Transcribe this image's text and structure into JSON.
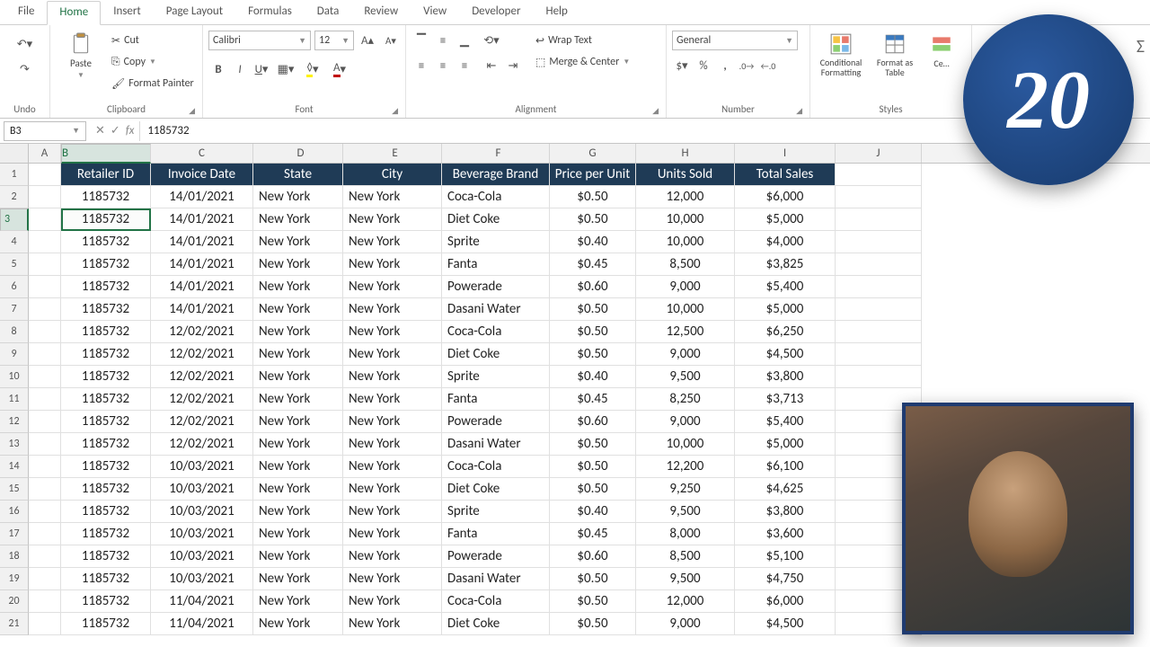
{
  "menu": {
    "tabs": [
      "File",
      "Home",
      "Insert",
      "Page Layout",
      "Formulas",
      "Data",
      "Review",
      "View",
      "Developer",
      "Help"
    ],
    "active": 1
  },
  "ribbon": {
    "undo": {
      "label": "Undo"
    },
    "clipboard": {
      "label": "Clipboard",
      "paste": "Paste",
      "cut": "Cut",
      "copy": "Copy",
      "format_painter": "Format Painter"
    },
    "font": {
      "label": "Font",
      "name": "Calibri",
      "size": "12"
    },
    "alignment": {
      "label": "Alignment",
      "wrap": "Wrap Text",
      "merge": "Merge & Center"
    },
    "number": {
      "label": "Number",
      "format": "General"
    },
    "styles": {
      "label": "Styles",
      "conditional": "Conditional Formatting",
      "format_table": "Format as Table",
      "cell_styles": "Cell Styles"
    }
  },
  "formula_bar": {
    "name_box": "B3",
    "value": "1185732"
  },
  "columns": [
    "A",
    "B",
    "C",
    "D",
    "E",
    "F",
    "G",
    "H",
    "I",
    "J"
  ],
  "headers": {
    "B": "Retailer ID",
    "C": "Invoice Date",
    "D": "State",
    "E": "City",
    "F": "Beverage Brand",
    "G": "Price per Unit",
    "H": "Units Sold",
    "I": "Total Sales"
  },
  "rows": [
    {
      "n": 2,
      "b": "1185732",
      "c": "14/01/2021",
      "d": "New York",
      "e": "New York",
      "f": "Coca-Cola",
      "g": "$0.50",
      "h": "12,000",
      "i": "$6,000"
    },
    {
      "n": 3,
      "b": "1185732",
      "c": "14/01/2021",
      "d": "New York",
      "e": "New York",
      "f": "Diet Coke",
      "g": "$0.50",
      "h": "10,000",
      "i": "$5,000"
    },
    {
      "n": 4,
      "b": "1185732",
      "c": "14/01/2021",
      "d": "New York",
      "e": "New York",
      "f": "Sprite",
      "g": "$0.40",
      "h": "10,000",
      "i": "$4,000"
    },
    {
      "n": 5,
      "b": "1185732",
      "c": "14/01/2021",
      "d": "New York",
      "e": "New York",
      "f": "Fanta",
      "g": "$0.45",
      "h": "8,500",
      "i": "$3,825"
    },
    {
      "n": 6,
      "b": "1185732",
      "c": "14/01/2021",
      "d": "New York",
      "e": "New York",
      "f": "Powerade",
      "g": "$0.60",
      "h": "9,000",
      "i": "$5,400"
    },
    {
      "n": 7,
      "b": "1185732",
      "c": "14/01/2021",
      "d": "New York",
      "e": "New York",
      "f": "Dasani Water",
      "g": "$0.50",
      "h": "10,000",
      "i": "$5,000"
    },
    {
      "n": 8,
      "b": "1185732",
      "c": "12/02/2021",
      "d": "New York",
      "e": "New York",
      "f": "Coca-Cola",
      "g": "$0.50",
      "h": "12,500",
      "i": "$6,250"
    },
    {
      "n": 9,
      "b": "1185732",
      "c": "12/02/2021",
      "d": "New York",
      "e": "New York",
      "f": "Diet Coke",
      "g": "$0.50",
      "h": "9,000",
      "i": "$4,500"
    },
    {
      "n": 10,
      "b": "1185732",
      "c": "12/02/2021",
      "d": "New York",
      "e": "New York",
      "f": "Sprite",
      "g": "$0.40",
      "h": "9,500",
      "i": "$3,800"
    },
    {
      "n": 11,
      "b": "1185732",
      "c": "12/02/2021",
      "d": "New York",
      "e": "New York",
      "f": "Fanta",
      "g": "$0.45",
      "h": "8,250",
      "i": "$3,713"
    },
    {
      "n": 12,
      "b": "1185732",
      "c": "12/02/2021",
      "d": "New York",
      "e": "New York",
      "f": "Powerade",
      "g": "$0.60",
      "h": "9,000",
      "i": "$5,400"
    },
    {
      "n": 13,
      "b": "1185732",
      "c": "12/02/2021",
      "d": "New York",
      "e": "New York",
      "f": "Dasani Water",
      "g": "$0.50",
      "h": "10,000",
      "i": "$5,000"
    },
    {
      "n": 14,
      "b": "1185732",
      "c": "10/03/2021",
      "d": "New York",
      "e": "New York",
      "f": "Coca-Cola",
      "g": "$0.50",
      "h": "12,200",
      "i": "$6,100"
    },
    {
      "n": 15,
      "b": "1185732",
      "c": "10/03/2021",
      "d": "New York",
      "e": "New York",
      "f": "Diet Coke",
      "g": "$0.50",
      "h": "9,250",
      "i": "$4,625"
    },
    {
      "n": 16,
      "b": "1185732",
      "c": "10/03/2021",
      "d": "New York",
      "e": "New York",
      "f": "Sprite",
      "g": "$0.40",
      "h": "9,500",
      "i": "$3,800"
    },
    {
      "n": 17,
      "b": "1185732",
      "c": "10/03/2021",
      "d": "New York",
      "e": "New York",
      "f": "Fanta",
      "g": "$0.45",
      "h": "8,000",
      "i": "$3,600"
    },
    {
      "n": 18,
      "b": "1185732",
      "c": "10/03/2021",
      "d": "New York",
      "e": "New York",
      "f": "Powerade",
      "g": "$0.60",
      "h": "8,500",
      "i": "$5,100"
    },
    {
      "n": 19,
      "b": "1185732",
      "c": "10/03/2021",
      "d": "New York",
      "e": "New York",
      "f": "Dasani Water",
      "g": "$0.50",
      "h": "9,500",
      "i": "$4,750"
    },
    {
      "n": 20,
      "b": "1185732",
      "c": "11/04/2021",
      "d": "New York",
      "e": "New York",
      "f": "Coca-Cola",
      "g": "$0.50",
      "h": "12,000",
      "i": "$6,000"
    },
    {
      "n": 21,
      "b": "1185732",
      "c": "11/04/2021",
      "d": "New York",
      "e": "New York",
      "f": "Diet Coke",
      "g": "$0.50",
      "h": "9,000",
      "i": "$4,500"
    }
  ],
  "overlay": {
    "bubble": "20"
  },
  "active_cell": {
    "row": 3,
    "col": "B"
  }
}
